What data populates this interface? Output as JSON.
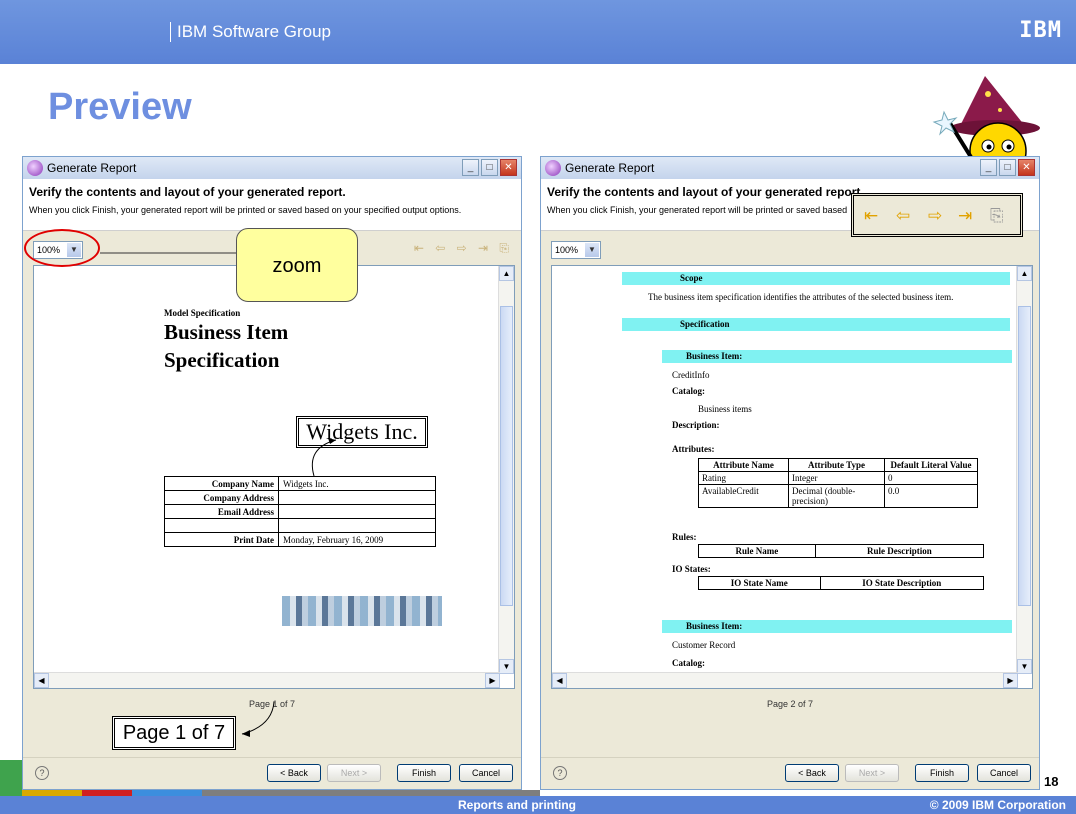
{
  "slide": {
    "group": "IBM Software Group",
    "logo": "IBM",
    "title": "Preview",
    "footer_center": "Reports and printing",
    "footer_right": "© 2009 IBM Corporation",
    "slide_number": "18"
  },
  "left": {
    "window_title": "Generate Report",
    "heading": "Verify the contents and layout of your generated report.",
    "subheading": "When you click Finish, your generated report will be printed or saved based on your specified output options.",
    "zoom": "100%",
    "page_label": "Page 1 of 7",
    "page": {
      "small_title": "Model Specification",
      "big_title_1": "Business Item",
      "big_title_2": "Specification",
      "logo_text": "Widgets Inc.",
      "rows": [
        {
          "k": "Company Name",
          "v": "Widgets Inc."
        },
        {
          "k": "Company Address",
          "v": ""
        },
        {
          "k": "Email Address",
          "v": ""
        },
        {
          "k": "",
          "v": ""
        },
        {
          "k": "Print Date",
          "v": "Monday, February 16, 2009"
        }
      ]
    }
  },
  "right": {
    "window_title": "Generate Report",
    "heading": "Verify the contents and layout of your generated report.",
    "subheading": "When you click Finish, your generated report will be printed or saved based",
    "zoom": "100%",
    "page_label": "Page 2 of 7",
    "page": {
      "scope_label": "Scope",
      "scope_text": "The business item specification identifies the attributes of the selected business item.",
      "spec_label": "Specification",
      "bi_label": "Business Item:",
      "bi_name": "CreditInfo",
      "catalog_label": "Catalog:",
      "catalog_value": "Business items",
      "description_label": "Description:",
      "attributes_label": "Attributes:",
      "attr_headers": [
        "Attribute Name",
        "Attribute Type",
        "Default Literal Value"
      ],
      "attr_rows": [
        [
          "Rating",
          "Integer",
          "0"
        ],
        [
          "AvailableCredit",
          "Decimal (double-precision)",
          "0.0"
        ]
      ],
      "rules_label": "Rules:",
      "rule_headers": [
        "Rule Name",
        "Rule Description"
      ],
      "io_label": "IO States:",
      "io_headers": [
        "IO State Name",
        "IO State Description"
      ],
      "bi2_label": "Business Item:",
      "bi2_name": "Customer Record",
      "catalog2_label": "Catalog:"
    }
  },
  "buttons": {
    "back": "< Back",
    "next": "Next >",
    "finish": "Finish",
    "cancel": "Cancel"
  },
  "callouts": {
    "zoom": "zoom",
    "page": "Page 1 of 7"
  },
  "colors": {
    "header_blue": "#5a82d6",
    "title_blue": "#6e8fe0",
    "callout_yellow": "#ffff9e",
    "highlight_cyan": "#80f2f2"
  }
}
